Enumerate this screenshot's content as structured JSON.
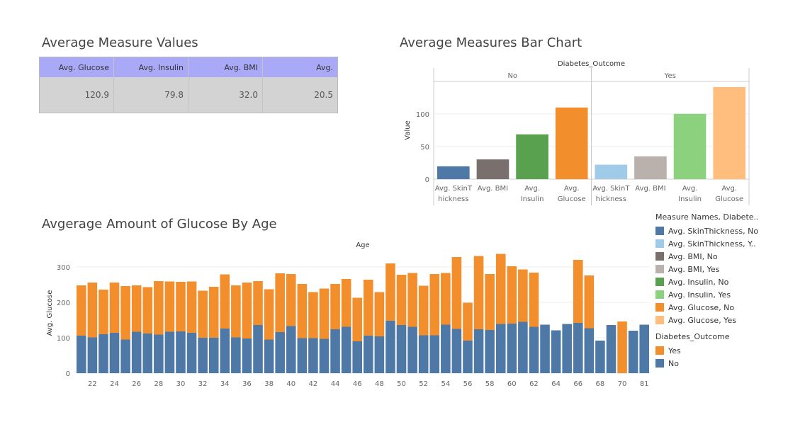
{
  "titles": {
    "table": "Average Measure Values",
    "bar": "Average Measures Bar Chart",
    "age": "Avgerage Amount of Glucose By Age"
  },
  "summary_table": {
    "headers": [
      "Avg. Glucose",
      "Avg. Insulin",
      "Avg. BMI",
      "Avg. SkinThickness"
    ],
    "values": [
      "120.9",
      "79.8",
      "32.0",
      "20.5"
    ],
    "header_color": "#a9a9f7",
    "cell_color": "#d3d3d3"
  },
  "legend": {
    "title1": "Measure Names, Diabete..",
    "items1": [
      {
        "label": "Avg. SkinThickness, No",
        "color": "#4e79a7"
      },
      {
        "label": "Avg. SkinThickness, Y..",
        "color": "#a0cbe8"
      },
      {
        "label": "Avg. BMI, No",
        "color": "#79706e"
      },
      {
        "label": "Avg. BMI, Yes",
        "color": "#bab0ac"
      },
      {
        "label": "Avg. Insulin, No",
        "color": "#59a14f"
      },
      {
        "label": "Avg. Insulin, Yes",
        "color": "#8cd17d"
      },
      {
        "label": "Avg. Glucose, No",
        "color": "#f28e2b"
      },
      {
        "label": "Avg. Glucose, Yes",
        "color": "#ffbe7d"
      }
    ],
    "title2": "Diabetes_Outcome",
    "items2": [
      {
        "label": "Yes",
        "color": "#f28e2b"
      },
      {
        "label": "No",
        "color": "#4e79a7"
      }
    ]
  },
  "chart_data": [
    {
      "type": "bar",
      "title": "Average Measures Bar Chart",
      "column_header": "Diabetes_Outcome",
      "panels": [
        "No",
        "Yes"
      ],
      "categories": [
        "Avg. SkinThickness",
        "Avg. BMI",
        "Avg. Insulin",
        "Avg. Glucose"
      ],
      "category_tick_lines": [
        [
          "Avg. SkinT",
          "hickness"
        ],
        [
          "Avg. BMI"
        ],
        [
          "Avg.",
          "Insulin"
        ],
        [
          "Avg.",
          "Glucose"
        ]
      ],
      "series": [
        {
          "name": "No",
          "values": [
            19.7,
            30.3,
            68.8,
            110.0
          ],
          "colors": [
            "#4e79a7",
            "#79706e",
            "#59a14f",
            "#f28e2b"
          ]
        },
        {
          "name": "Yes",
          "values": [
            22.2,
            35.1,
            100.3,
            141.3
          ],
          "colors": [
            "#a0cbe8",
            "#bab0ac",
            "#8cd17d",
            "#ffbe7d"
          ]
        }
      ],
      "ylabel": "Value",
      "ylim": [
        0,
        150
      ],
      "yticks": [
        0,
        50,
        100
      ],
      "grid": true
    },
    {
      "type": "bar",
      "stacked": true,
      "title": "Avgerage Amount of Glucose By Age",
      "column_header": "Age",
      "xlabel": "",
      "ylabel": "Avg. Glucose",
      "ylim": [
        0,
        340
      ],
      "yticks": [
        0,
        100,
        200,
        300
      ],
      "x": [
        21,
        22,
        23,
        24,
        25,
        26,
        27,
        28,
        29,
        30,
        31,
        32,
        33,
        34,
        35,
        36,
        37,
        38,
        39,
        40,
        41,
        42,
        43,
        44,
        45,
        46,
        47,
        48,
        49,
        50,
        51,
        52,
        53,
        54,
        55,
        56,
        57,
        58,
        59,
        60,
        61,
        62,
        63,
        64,
        65,
        66,
        67,
        68,
        69,
        70,
        72,
        81
      ],
      "xtick_labels": [
        "22",
        "24",
        "26",
        "28",
        "30",
        "32",
        "34",
        "36",
        "38",
        "40",
        "42",
        "44",
        "46",
        "48",
        "50",
        "52",
        "54",
        "56",
        "58",
        "60",
        "62",
        "64",
        "66",
        "68",
        "70",
        "81"
      ],
      "xtick_indices": [
        1,
        3,
        5,
        7,
        9,
        11,
        13,
        15,
        17,
        19,
        21,
        23,
        25,
        27,
        29,
        31,
        33,
        35,
        37,
        39,
        41,
        43,
        45,
        47,
        49,
        51
      ],
      "series": [
        {
          "name": "No",
          "color": "#4e79a7",
          "values": [
            106,
            101,
            110,
            114,
            95,
            117,
            112,
            109,
            117,
            118,
            114,
            100,
            100,
            126,
            101,
            98,
            136,
            95,
            116,
            133,
            99,
            99,
            97,
            124,
            131,
            90,
            106,
            104,
            148,
            136,
            131,
            107,
            107,
            137,
            125,
            92,
            124,
            122,
            139,
            140,
            145,
            131,
            137,
            121,
            139,
            142,
            127,
            92,
            136,
            0,
            120,
            137
          ]
        },
        {
          "name": "Yes",
          "color": "#f28e2b",
          "values": [
            142,
            155,
            126,
            142,
            151,
            131,
            131,
            151,
            142,
            140,
            145,
            133,
            144,
            153,
            147,
            158,
            124,
            142,
            166,
            147,
            153,
            130,
            142,
            128,
            135,
            123,
            158,
            125,
            162,
            142,
            152,
            140,
            173,
            146,
            203,
            107,
            207,
            158,
            198,
            162,
            148,
            153,
            0,
            0,
            0,
            178,
            149,
            0,
            0,
            146,
            0,
            0
          ]
        }
      ],
      "grid": true
    }
  ]
}
